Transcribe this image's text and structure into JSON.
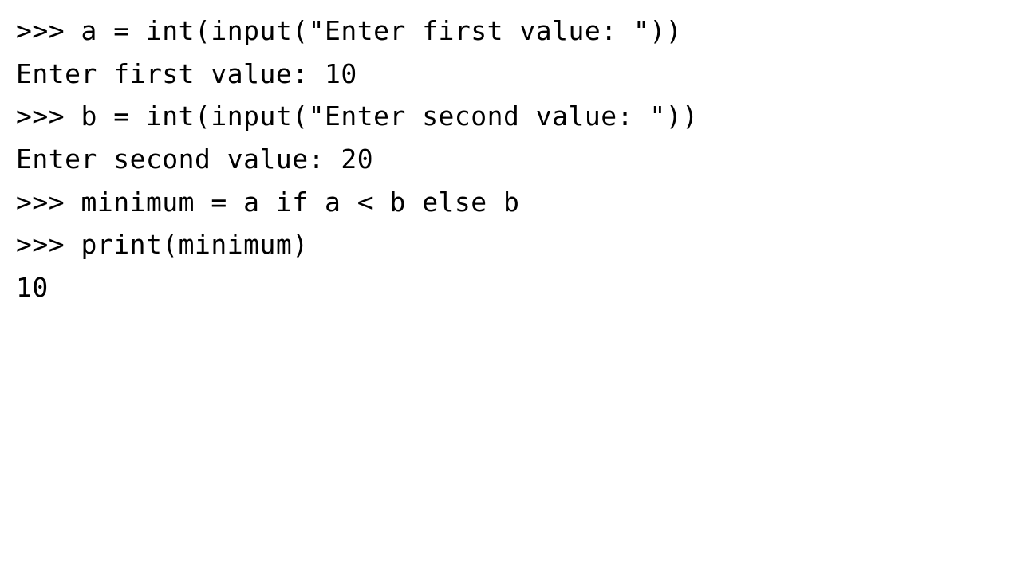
{
  "console": {
    "lines": [
      ">>> a = int(input(\"Enter first value: \"))",
      "Enter first value: 10",
      ">>> b = int(input(\"Enter second value: \"))",
      "Enter second value: 20",
      ">>> minimum = a if a < b else b",
      ">>> print(minimum)",
      "10"
    ]
  }
}
